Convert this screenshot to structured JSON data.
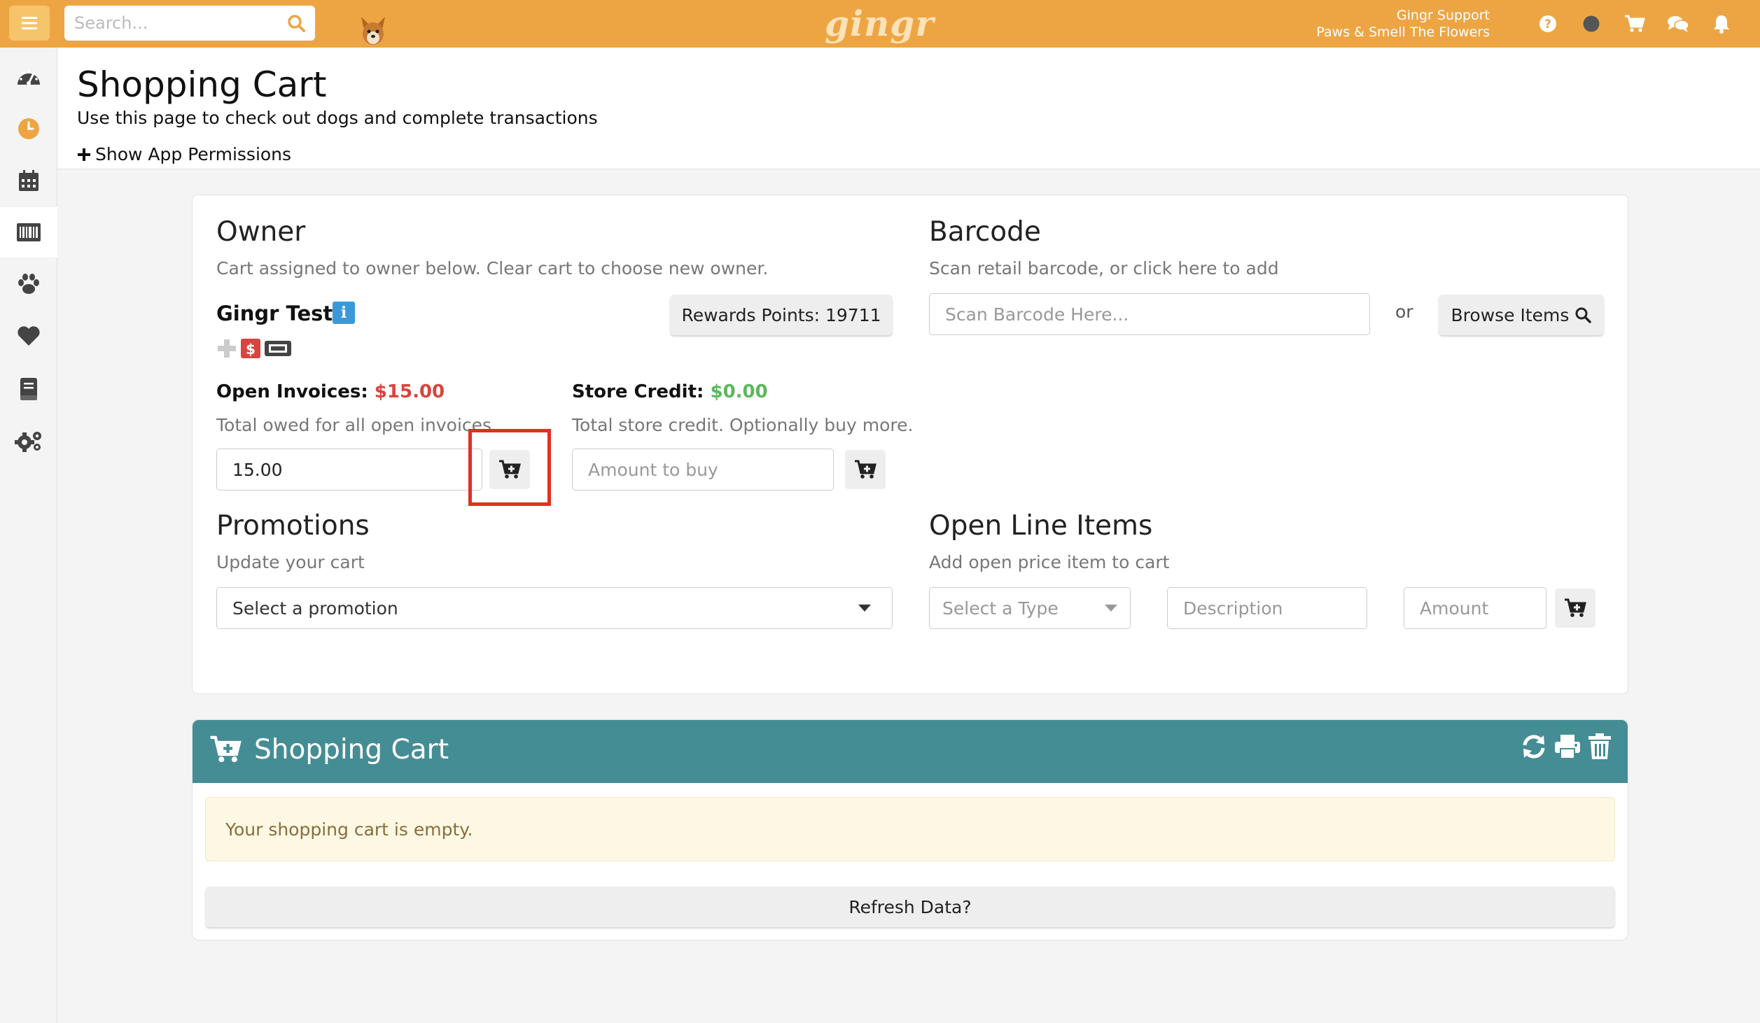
{
  "topbar": {
    "search_placeholder": "Search...",
    "logo": "gingr",
    "user_name": "Gingr Support",
    "location": "Paws & Smell The Flowers",
    "icons": [
      "help-icon",
      "status-dot-icon",
      "cart-icon",
      "chat-icon",
      "bell-icon"
    ],
    "accent_color": "#eda544"
  },
  "sidebar": {
    "items": [
      "dashboard-icon",
      "clock-icon",
      "calendar-icon",
      "barcode-icon",
      "paw-icon",
      "heart-icon",
      "book-icon",
      "settings-icon"
    ],
    "active": "barcode-icon"
  },
  "page": {
    "title": "Shopping Cart",
    "subtitle": "Use this page to check out dogs and complete transactions",
    "permissions_label": "Show App Permissions"
  },
  "owner": {
    "title": "Owner",
    "subtitle": "Cart assigned to owner below. Clear cart to choose new owner.",
    "name": "Gingr Test",
    "info_badge": "i",
    "rewards_label": "Rewards Points:  19711"
  },
  "barcode": {
    "title": "Barcode",
    "subtitle": "Scan retail barcode, or click here to add",
    "placeholder": "Scan Barcode Here...",
    "or_label": "or",
    "browse_label": "Browse Items"
  },
  "invoices": {
    "label": "Open Invoices:",
    "amount": "$15.00",
    "description": "Total owed for all open invoices",
    "input_value": "15.00"
  },
  "store_credit": {
    "label": "Store Credit:",
    "amount": "$0.00",
    "description": "Total store credit. Optionally buy more.",
    "placeholder": "Amount to buy"
  },
  "promotions": {
    "title": "Promotions",
    "subtitle": "Update your cart",
    "select_value": "Select a promotion"
  },
  "open_line_items": {
    "title": "Open Line Items",
    "subtitle": "Add open price item to cart",
    "type_select": "Select a Type",
    "description_placeholder": "Description",
    "amount_placeholder": "Amount"
  },
  "cart": {
    "title": "Shopping Cart",
    "empty_message": "Your shopping cart is empty.",
    "refresh_label": "Refresh Data?",
    "header_color": "#458d94",
    "actions": [
      "refresh-icon",
      "print-icon",
      "trash-icon"
    ]
  }
}
